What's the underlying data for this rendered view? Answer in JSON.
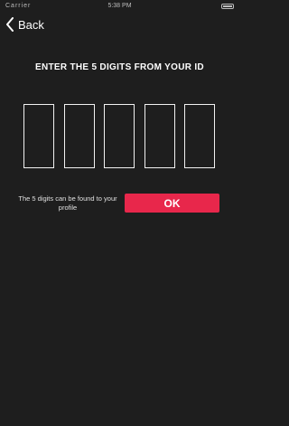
{
  "status_bar": {
    "time": "5:38 PM",
    "carrier": "Carrier"
  },
  "nav": {
    "back_label": "Back",
    "back_icon": "chevron-left-icon"
  },
  "title": "ENTER THE 5 DIGITS FROM YOUR ID",
  "digit_inputs": [
    "",
    "",
    "",
    "",
    ""
  ],
  "hint": "The 5 digits can be found to your profile",
  "ok_label": "OK",
  "colors": {
    "background": "#1e1e1e",
    "accent": "#e8274b",
    "text": "#ffffff"
  }
}
